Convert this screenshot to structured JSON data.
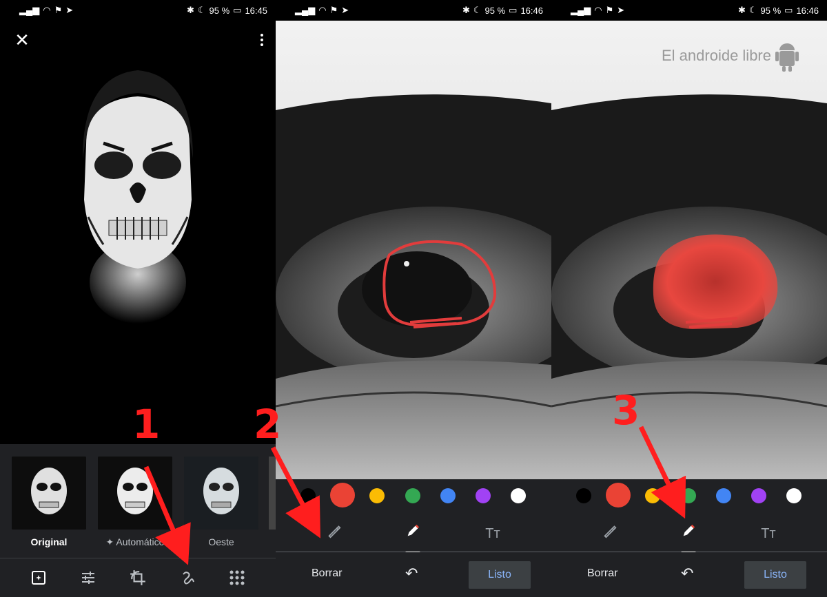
{
  "screens": [
    {
      "status": {
        "signal": "▂▄▆",
        "battery_pct": "95 %",
        "time": "16:45"
      }
    },
    {
      "status": {
        "signal": "▂▄▆",
        "battery_pct": "95 %",
        "time": "16:46"
      }
    },
    {
      "status": {
        "signal": "▂▄▆",
        "battery_pct": "95 %",
        "time": "16:46"
      }
    }
  ],
  "editor": {
    "close_icon": "✕",
    "filters": [
      {
        "label": "Original"
      },
      {
        "label": "Automático",
        "icon": "✦"
      },
      {
        "label": "Oeste"
      }
    ],
    "tools": [
      "suggestions-icon",
      "adjust-icon",
      "crop-rotate-icon",
      "markup-icon",
      "more-tools-icon"
    ]
  },
  "markup": {
    "colors": [
      "#000000",
      "#ea4335",
      "#fbbc04",
      "#34a853",
      "#4285f4",
      "#a142f4",
      "#ffffff"
    ],
    "selected_color": "#ea4335",
    "pens": {
      "highlighter": "highlighter-icon",
      "pen": "pen-icon",
      "text": "Tт"
    },
    "clear_label": "Borrar",
    "undo_icon": "↶",
    "done_label": "Listo"
  },
  "watermark": "El androide libre",
  "annotations": [
    "1",
    "2",
    "3"
  ],
  "annotation_color": "#ff1e1e"
}
